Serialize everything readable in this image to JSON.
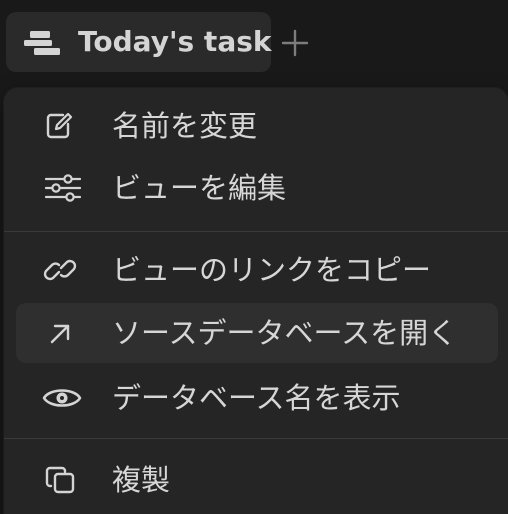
{
  "tab": {
    "label": "Today's task",
    "icon": "table-view-icon"
  },
  "add_tab": {
    "icon": "plus-icon"
  },
  "menu": {
    "items": [
      {
        "label": "名前を変更",
        "icon": "edit-icon"
      },
      {
        "label": "ビューを編集",
        "icon": "sliders-icon"
      },
      {
        "label": "ビューのリンクをコピー",
        "icon": "link-icon"
      },
      {
        "label": "ソースデータベースを開く",
        "icon": "arrow-up-right-icon",
        "highlighted": true
      },
      {
        "label": "データベース名を表示",
        "icon": "eye-icon"
      },
      {
        "label": "複製",
        "icon": "duplicate-icon"
      }
    ]
  },
  "colors": {
    "background": "#191919",
    "menu_background": "#252525",
    "highlight": "#2f2f2f",
    "text": "#d6d6d6"
  }
}
